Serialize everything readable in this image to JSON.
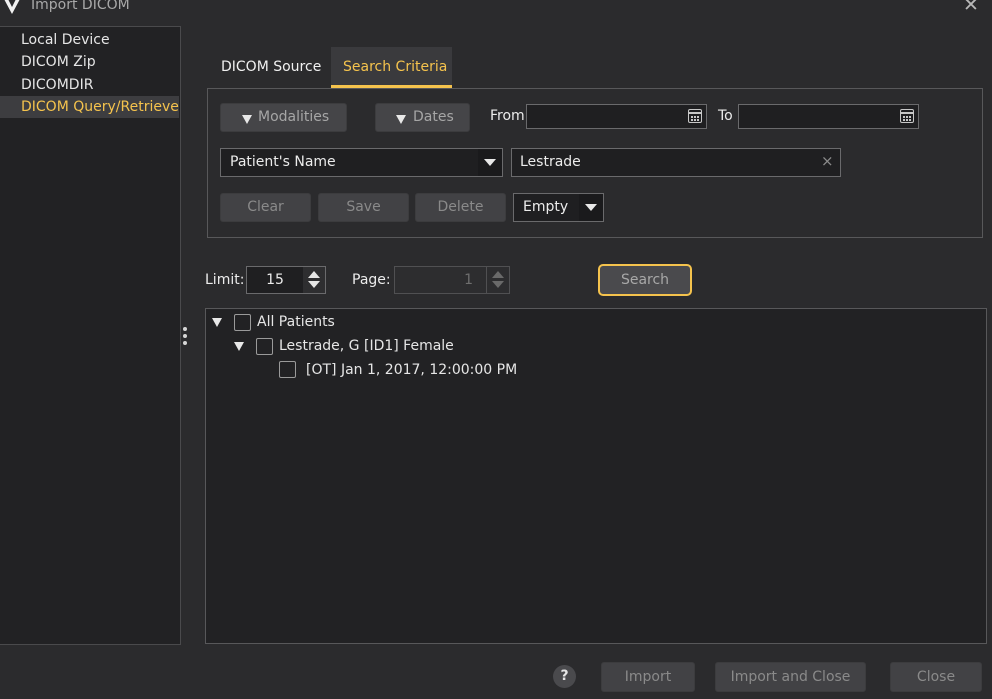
{
  "window": {
    "title": "Import DICOM",
    "close_glyph": "✕",
    "logo_icon": "app-v-logo-icon"
  },
  "sidebar": {
    "items": [
      {
        "label": "Local Device"
      },
      {
        "label": "DICOM Zip"
      },
      {
        "label": "DICOMDIR"
      },
      {
        "label": "DICOM Query/Retrieve"
      }
    ],
    "active_index": 3
  },
  "tabs": [
    {
      "label": "DICOM Source",
      "active": false
    },
    {
      "label": "Search Criteria",
      "active": true
    }
  ],
  "criteria": {
    "modalities_label": "Modalities",
    "dates_label": "Dates",
    "from_label": "From",
    "from_value": "",
    "to_label": "To",
    "to_value": "",
    "field_select": "Patient's Name",
    "field_value": "Lestrade",
    "clear_label": "Clear",
    "save_label": "Save",
    "delete_label": "Delete",
    "preset_select": "Empty"
  },
  "paging": {
    "limit_label": "Limit:",
    "limit_value": "15",
    "page_label": "Page:",
    "page_value": "1",
    "search_label": "Search"
  },
  "tree": {
    "root": {
      "label": "All Patients",
      "expanded": true,
      "checked": false
    },
    "patients": [
      {
        "label": "Lestrade, G [ID1]  Female",
        "expanded": true,
        "checked": false,
        "studies": [
          {
            "label": "[OT] Jan 1, 2017, 12:00:00 PM",
            "checked": false
          }
        ]
      }
    ]
  },
  "footer": {
    "help_label": "?",
    "import_label": "Import",
    "import_close_label": "Import and Close",
    "close_label": "Close"
  },
  "colors": {
    "accent": "#f5c34d",
    "background": "#2b2b2d",
    "panel": "#222224"
  }
}
